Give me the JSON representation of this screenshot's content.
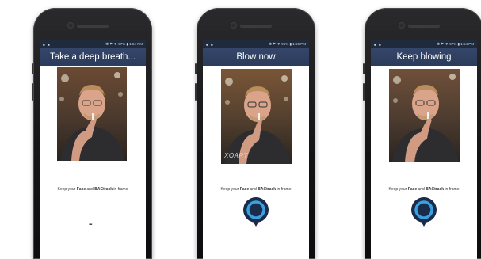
{
  "screens": [
    {
      "status_left": "■ ■",
      "status_right": "✱ ⚑ ▼ 97% ▮ 1:54 PM",
      "title": "Take a deep breath...",
      "hint_pre": "Keep your ",
      "hint_b1": "Face",
      "hint_mid": " and ",
      "hint_b2": "BACtrack",
      "hint_post": " in frame",
      "home_indicator": "▪▪▪",
      "watermark": ""
    },
    {
      "status_left": "■ ■",
      "status_right": "✱ ⚑ ▼ 95% ▮ 1:59 PM",
      "title": "Blow now",
      "hint_pre": "Keep your ",
      "hint_b1": "Face",
      "hint_mid": " and ",
      "hint_b2": "BACtrack",
      "hint_post": " in frame",
      "watermark": "XOART"
    },
    {
      "status_left": "■ ■",
      "status_right": "✱ ⚑ ▼ 97% ▮ 1:54 PM",
      "title": "Keep blowing",
      "hint_pre": "Keep your ",
      "hint_b1": "Face",
      "hint_mid": " and ",
      "hint_b2": "BACtrack",
      "hint_post": " in frame",
      "watermark": ""
    }
  ],
  "colors": {
    "title_bar": "#2f4062",
    "blow_ring": "#1b2c4a",
    "blow_glow": "#3aa0e0"
  }
}
